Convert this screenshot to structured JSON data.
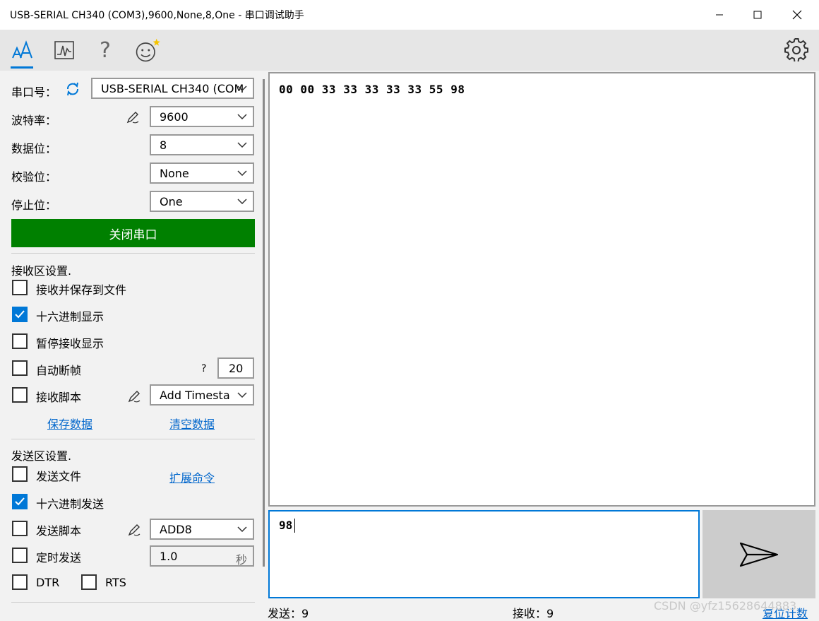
{
  "window": {
    "title": "USB-SERIAL CH340 (COM3),9600,None,8,One - 串口调试助手"
  },
  "toolbar": {
    "icons": [
      "font-size-icon",
      "chart-icon",
      "help-icon",
      "smiley-icon",
      "settings-icon"
    ],
    "help_glyph": "?"
  },
  "serial": {
    "port_label": "串口号：",
    "port_value": "USB-SERIAL CH340 (COM",
    "baud_label": "波特率：",
    "baud_value": "9600",
    "databits_label": "数据位：",
    "databits_value": "8",
    "parity_label": "校验位：",
    "parity_value": "None",
    "stopbits_label": "停止位：",
    "stopbits_value": "One",
    "close_button": "关闭串口"
  },
  "receive_settings": {
    "header": "接收区设置.",
    "save_to_file": "接收并保存到文件",
    "hex_display": "十六进制显示",
    "pause_display": "暂停接收显示",
    "auto_frame": "自动断帧",
    "auto_frame_help": "?",
    "auto_frame_value": "20",
    "receive_script": "接收脚本",
    "receive_script_value": "Add Timesta",
    "save_data_link": "保存数据",
    "clear_data_link": "清空数据"
  },
  "send_settings": {
    "header": "发送区设置.",
    "send_file": "发送文件",
    "extend_commands_link": "扩展命令",
    "hex_send": "十六进制发送",
    "send_script": "发送脚本",
    "send_script_value": "ADD8",
    "timed_send": "定时发送",
    "timed_send_value": "1.0",
    "timed_send_unit": "秒",
    "dtr": "DTR",
    "rts": "RTS"
  },
  "checkbox_states": {
    "save_to_file": false,
    "hex_display": true,
    "pause_display": false,
    "auto_frame": false,
    "receive_script": false,
    "send_file": false,
    "hex_send": true,
    "send_script": false,
    "timed_send": false,
    "dtr": false,
    "rts": false
  },
  "receive_area": {
    "content": "00 00 33 33 33 33 33 55 98"
  },
  "send_area": {
    "content": "98"
  },
  "status": {
    "sent_label": "发送：9",
    "received_label": "接收：9",
    "reset_count_link": "复位计数"
  },
  "watermark": "CSDN @yfz15628644883",
  "colors": {
    "accent": "#0078d7",
    "close_button_bg": "#008000",
    "link": "#0066cc"
  }
}
